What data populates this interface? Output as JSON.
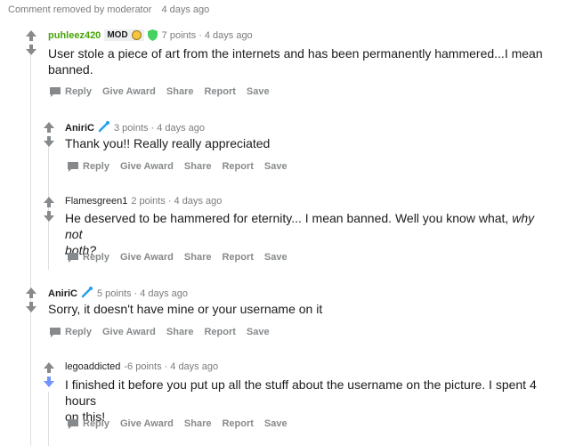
{
  "top": {
    "removed_text": "Comment removed by moderator",
    "time": "4 days ago"
  },
  "actions": {
    "reply": "Reply",
    "give_award": "Give Award",
    "share": "Share",
    "report": "Report",
    "save": "Save"
  },
  "comments": [
    {
      "author": "puhleez420",
      "badge": "MOD",
      "points": "7 points",
      "time": "4 days ago",
      "body_line1": "User stole a piece of art from the internets and has been permanently hammered...I mean",
      "body_line2": "banned."
    },
    {
      "author": "AniriC",
      "points": "3 points",
      "time": "4 days ago",
      "body_line1": "Thank you!! Really really appreciated"
    },
    {
      "author": "Flamesgreen1",
      "points": "2 points",
      "time": "4 days ago",
      "body_line1": "He deserved to be hammered for eternity... I mean banned. Well you know what,",
      "body_em1": "why not",
      "body_em2": "both?"
    },
    {
      "author": "AniriC",
      "points": "5 points",
      "time": "4 days ago",
      "body_line1": "Sorry, it doesn't have mine or your username on it"
    },
    {
      "author": "legoaddicted",
      "points": "-6 points",
      "time": "4 days ago",
      "body_line1": "I finished it before you put up all the stuff about the username on the picture. I spent 4 hours",
      "body_line2": "on this!"
    }
  ],
  "colors": {
    "mod_green": "#46a508",
    "downvoted_blue": "#7193ff",
    "muted": "#878a8c"
  },
  "icons": [
    "upvote-arrow",
    "downvote-arrow",
    "shield",
    "magic-wand",
    "reply-bubble",
    "emoji-face"
  ]
}
